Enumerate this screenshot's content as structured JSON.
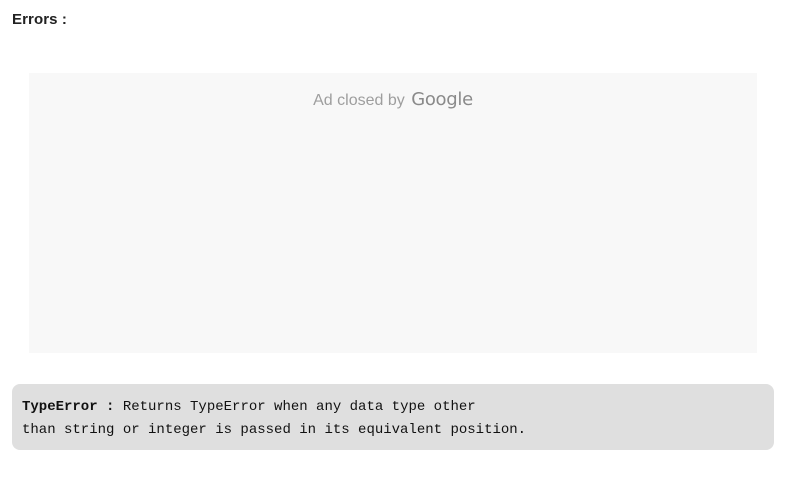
{
  "section": {
    "heading": "Errors :"
  },
  "ad": {
    "closed_text": "Ad closed by",
    "brand": "Google"
  },
  "error_info": {
    "term": "TypeError :",
    "line1_text": " Returns TypeError when any data type other",
    "line2_text": "than string or integer is passed in its equivalent position."
  }
}
